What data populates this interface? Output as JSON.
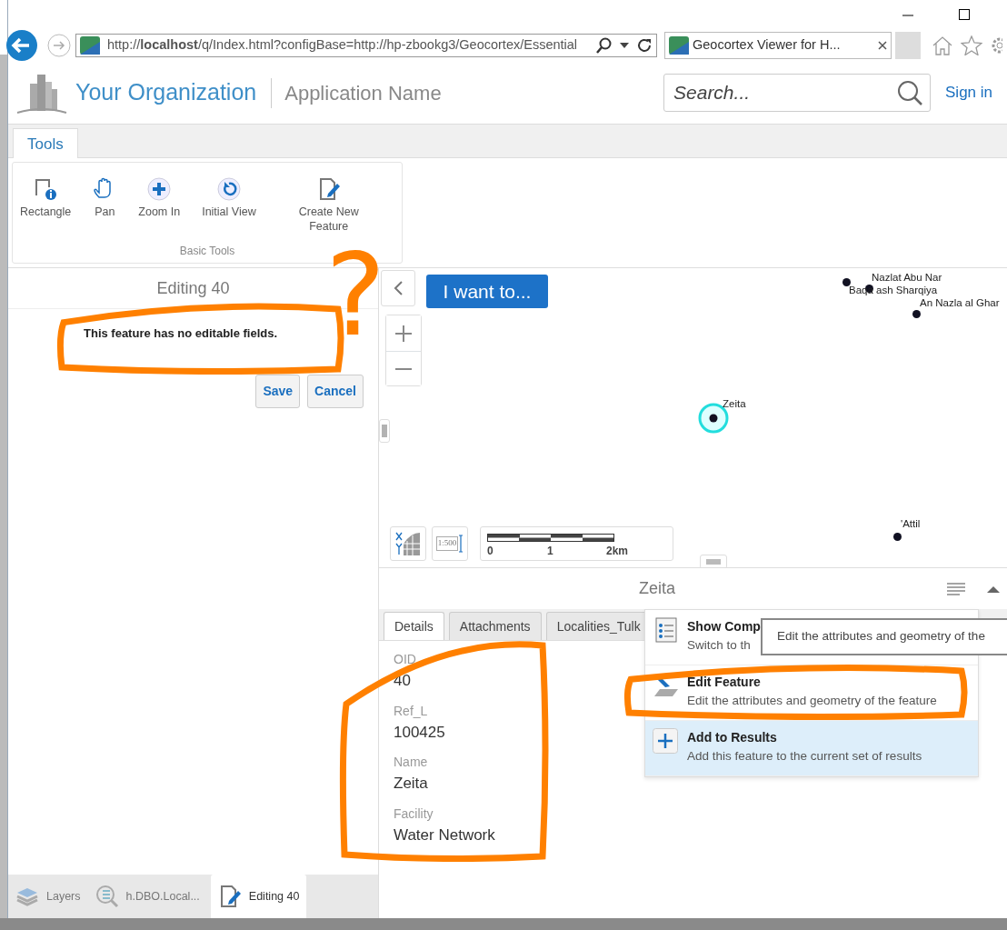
{
  "browser": {
    "url": "http://**localhost**/q/Index.html?configBase=http://hp-zbookg3/Geocortex/Essential",
    "tab_title": "Geocortex Viewer for H..."
  },
  "header": {
    "organization": "Your Organization",
    "application": "Application Name",
    "search_placeholder": "Search...",
    "sign_in": "Sign in"
  },
  "ribbon": {
    "tab": "Tools",
    "tools": [
      {
        "kind": "rectangle",
        "label": "Rectangle"
      },
      {
        "kind": "pan",
        "label": "Pan"
      },
      {
        "kind": "zoom",
        "label": "Zoom In"
      },
      {
        "kind": "initial",
        "label": "Initial View"
      },
      {
        "kind": "create",
        "label": "Create New Feature"
      }
    ],
    "group": "Basic Tools"
  },
  "editor": {
    "title": "Editing 40",
    "message": "This feature has no editable fields.",
    "buttons": [
      "Save",
      "Cancel"
    ]
  },
  "bottom_tabs": [
    {
      "kind": "layers",
      "label": "Layers",
      "selected": false
    },
    {
      "kind": "results",
      "label": "h.DBO.Local...",
      "selected": false
    },
    {
      "kind": "edit",
      "label": "Editing 40",
      "selected": true
    }
  ],
  "map": {
    "i_want_to": "I want to...",
    "places": [
      {
        "label": "Nazlat Abu Nar",
        "selected": false
      },
      {
        "label": "Baqa ash Sharqiya",
        "selected": false
      },
      {
        "label": "An Nazla al Ghar",
        "selected": false
      },
      {
        "label": "Zeita",
        "selected": true
      },
      {
        "label": "'Attil",
        "selected": false
      }
    ],
    "scale_ratio": "1:500",
    "scale_labels": [
      "0",
      "1",
      "2km"
    ]
  },
  "results": {
    "title": "Zeita",
    "tabs": [
      {
        "label": "Details",
        "selected": true
      },
      {
        "label": "Attachments",
        "selected": false
      },
      {
        "label": "Localities_Tulk",
        "selected": false
      }
    ],
    "fields": [
      {
        "label": "OID",
        "value": "40"
      },
      {
        "label": "Ref_L",
        "value": "100425"
      },
      {
        "label": "Name",
        "value": "Zeita"
      },
      {
        "label": "Facility",
        "value": "Water Network"
      }
    ],
    "menu": [
      {
        "kind": "compact",
        "title": "Show Comp",
        "description": "Switch to th",
        "highlighted": false
      },
      {
        "kind": "edit",
        "title": "Edit Feature",
        "description": "Edit the attributes and geometry of the feature",
        "highlighted": false
      },
      {
        "kind": "add",
        "title": "Add to Results",
        "description": "Add this feature to the current set of results",
        "highlighted": true
      }
    ],
    "tooltip": "Edit the attributes and geometry of the"
  },
  "annotations": [
    {
      "kind": "loop"
    },
    {
      "kind": "mark",
      "text": "?"
    },
    {
      "kind": "loop"
    },
    {
      "kind": "loop"
    }
  ]
}
